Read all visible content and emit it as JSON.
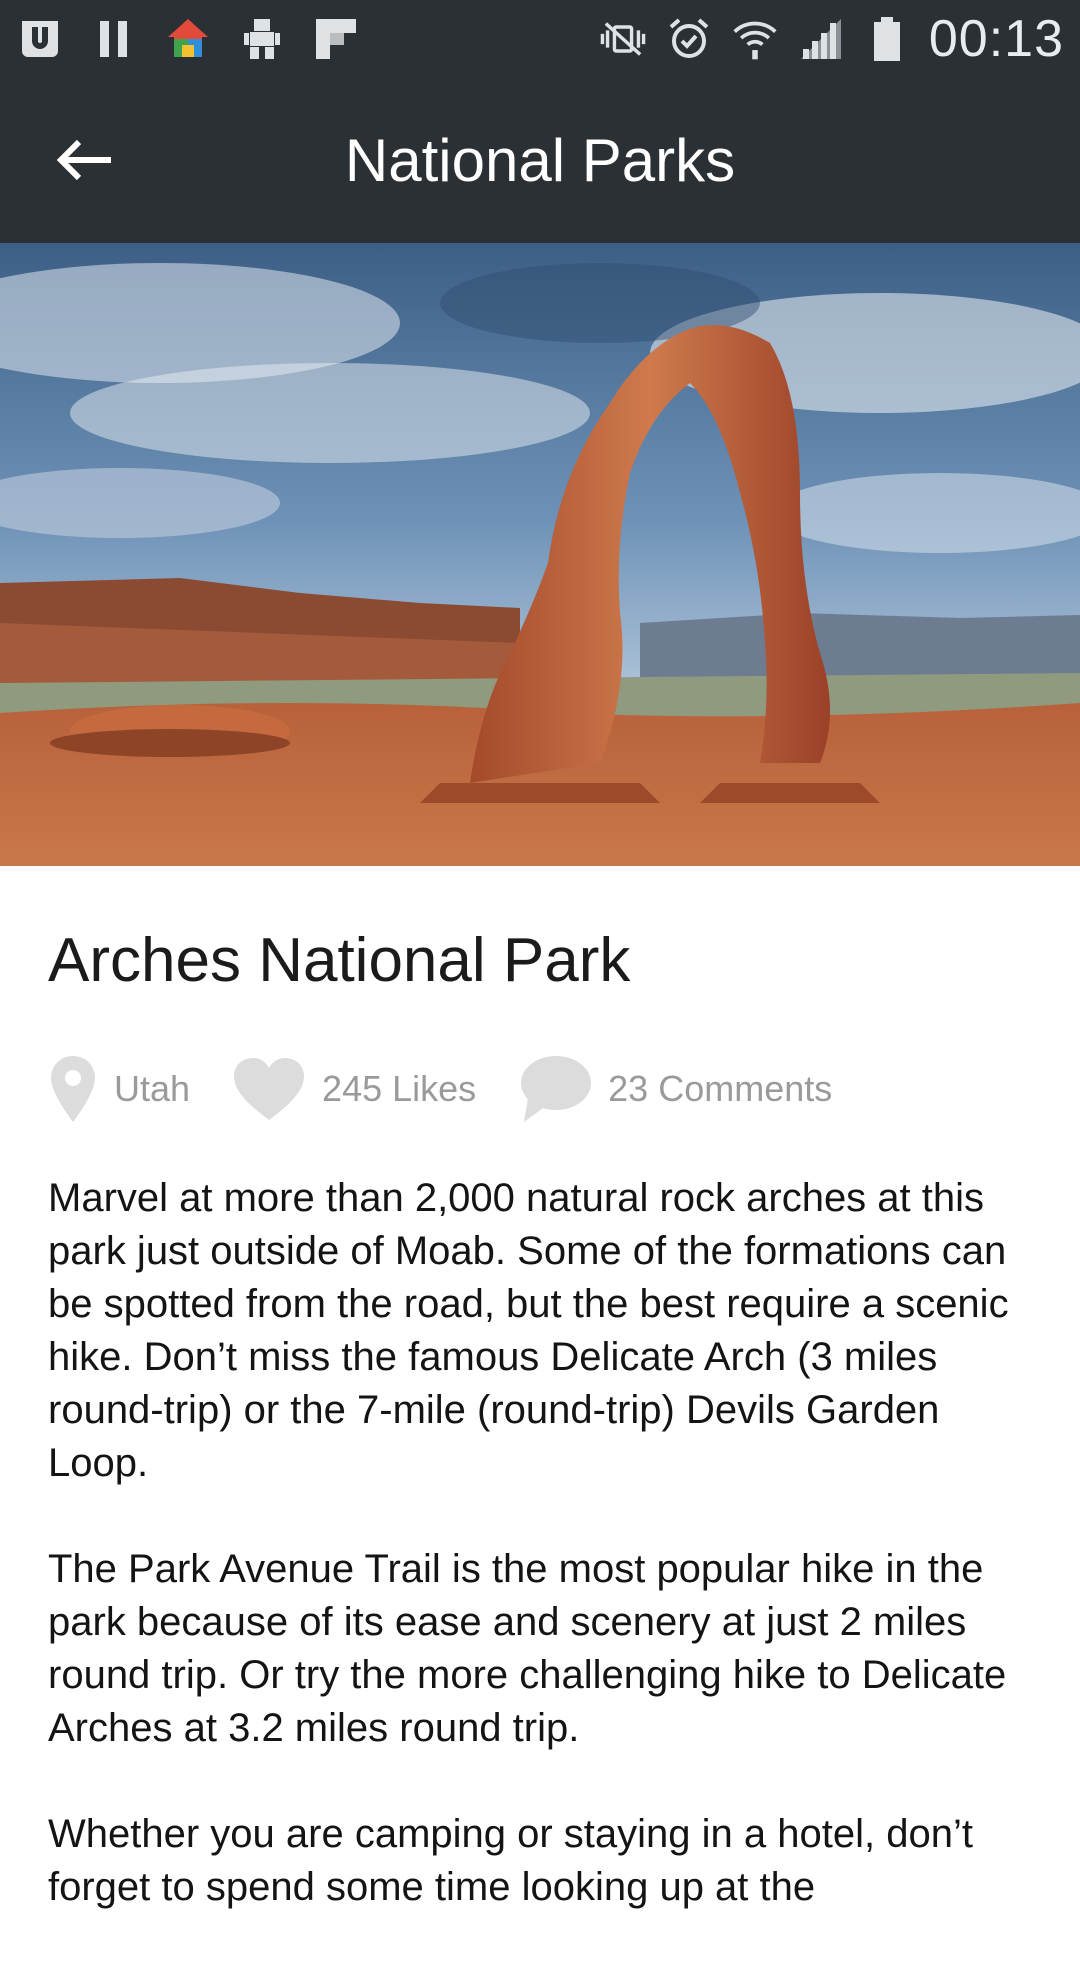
{
  "status_bar": {
    "icons_left": [
      "uber-icon",
      "pause-icon",
      "home-launcher-icon",
      "robot-icon",
      "flipboard-icon"
    ],
    "icons_right": [
      "vibrate-icon",
      "alarm-icon",
      "wifi-icon",
      "signal-icon",
      "battery-icon"
    ],
    "time": "00:13"
  },
  "app_bar": {
    "back_icon": "arrow-left-icon",
    "title": "National Parks"
  },
  "hero": {
    "description_icon": "hero-photo"
  },
  "park": {
    "name": "Arches National Park",
    "location": "Utah",
    "likes": "245 Likes",
    "comments": "23 Comments",
    "paragraphs": [
      "Marvel at more than 2,000 natural rock arches at this park just outside of Moab. Some of the formations can be spotted from the road, but the best require a scenic hike. Don’t miss the famous Delicate Arch (3 miles round-trip) or the 7-mile (round-trip) Devils Garden Loop.",
      "The Park Avenue Trail is the most popular hike in the park because of its ease and scenery at just 2 miles round trip. Or try the more challenging hike to Delicate Arches at 3.2 miles round trip.",
      "Whether you are camping or staying in a hotel, don’t forget to spend some time looking up at the"
    ]
  },
  "colors": {
    "bar_background": "#2b3034",
    "meta_gray": "#9a9a9a",
    "body_text": "#141414"
  }
}
